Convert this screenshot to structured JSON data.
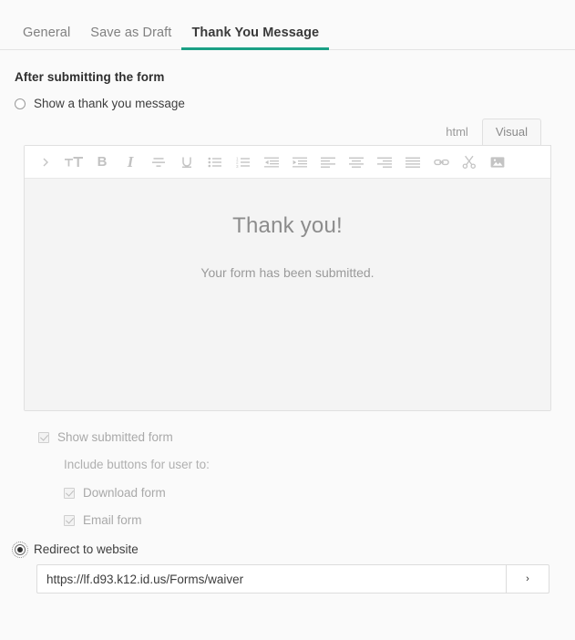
{
  "tabs": [
    {
      "label": "General",
      "active": false
    },
    {
      "label": "Save as Draft",
      "active": false
    },
    {
      "label": "Thank You Message",
      "active": true
    }
  ],
  "section": {
    "heading": "After submitting the form"
  },
  "options": {
    "show_message": {
      "label": "Show a thank you message",
      "selected": false
    },
    "redirect": {
      "label": "Redirect to website",
      "selected": true
    }
  },
  "editor": {
    "mode_tabs": [
      {
        "label": "html",
        "active": false
      },
      {
        "label": "Visual",
        "active": true
      }
    ],
    "toolbar": [
      "chevron-right-icon",
      "font-size-icon",
      "bold-icon",
      "italic-icon",
      "strikethrough-icon",
      "underline-icon",
      "bullet-list-icon",
      "numbered-list-icon",
      "outdent-icon",
      "indent-icon",
      "align-left-icon",
      "align-center-icon",
      "align-right-icon",
      "align-justify-icon",
      "link-icon",
      "scissors-icon",
      "image-icon"
    ],
    "content": {
      "title": "Thank you!",
      "subtitle": "Your form has been submitted."
    }
  },
  "checkboxes": {
    "show_submitted_form": {
      "label": "Show submitted form",
      "checked": true,
      "disabled": true
    },
    "include_note": "Include buttons for user to:",
    "download_form": {
      "label": "Download form",
      "checked": true,
      "disabled": true
    },
    "email_form": {
      "label": "Email form",
      "checked": true,
      "disabled": true
    }
  },
  "redirect_field": {
    "value": "https://lf.d93.k12.id.us/Forms/waiver",
    "placeholder": "https://",
    "go_label": "›"
  },
  "colors": {
    "accent": "#1aa085",
    "page_bg": "#fafafa",
    "editor_bg": "#f4f4f4"
  }
}
